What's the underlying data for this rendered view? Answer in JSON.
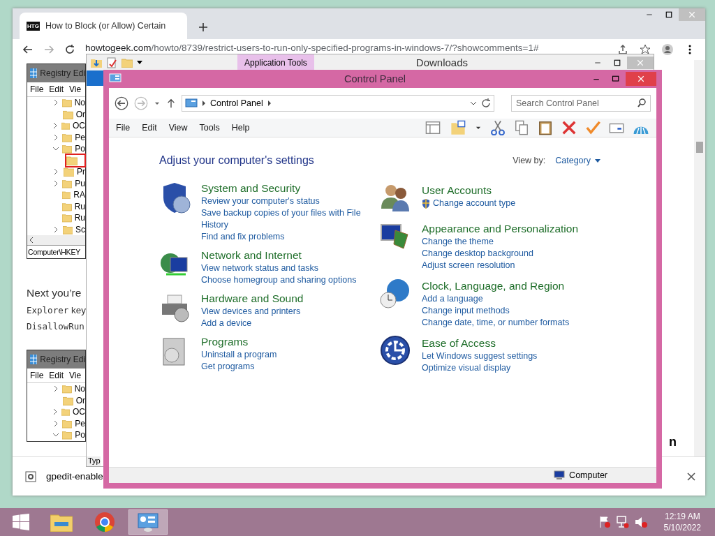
{
  "browser": {
    "tab": {
      "icon_text": "HTG",
      "title": "How to Block (or Allow) Certain"
    },
    "url": {
      "host": "howtogeek.com",
      "path": "/howto/8739/restrict-users-to-run-only-specified-programs-in-windows-7/?showcomments=1#"
    },
    "article": {
      "registry_shots": [
        {
          "title": "Registry Edi",
          "menu": [
            "File",
            "Edit",
            "Vie"
          ],
          "tree": [
            {
              "kind": "collapsed",
              "label": "No"
            },
            {
              "kind": "leaf",
              "label": "Or"
            },
            {
              "kind": "collapsed",
              "label": "OC"
            },
            {
              "kind": "collapsed",
              "label": "Pe"
            },
            {
              "kind": "expanded",
              "label": "Po"
            },
            {
              "kind": "child",
              "highlighted": true
            },
            {
              "kind": "collapsed",
              "label": "Pr"
            },
            {
              "kind": "collapsed",
              "label": "Pu"
            },
            {
              "kind": "leaf",
              "label": "RA"
            },
            {
              "kind": "leaf",
              "label": "Ru"
            },
            {
              "kind": "leaf",
              "label": "Ru"
            },
            {
              "kind": "collapsed",
              "label": "Sc"
            }
          ],
          "status": "Computer\\HKEY"
        },
        {
          "title": "Registry Edi",
          "menu": [
            "File",
            "Edit",
            "Vie"
          ],
          "tree": [
            {
              "kind": "collapsed",
              "label": "No"
            },
            {
              "kind": "leaf",
              "label": "Or"
            },
            {
              "kind": "collapsed",
              "label": "OC"
            },
            {
              "kind": "collapsed",
              "label": "Pe"
            },
            {
              "kind": "expanded",
              "label": "Po"
            }
          ]
        }
      ],
      "paragraph": "Next you’re",
      "code_lines": [
        {
          "code": "Explorer",
          "text": "key"
        },
        {
          "code": "DisallowRun"
        }
      ],
      "side_text": "n"
    },
    "download": {
      "file": "gpedit-enable"
    }
  },
  "downloads_window": {
    "ribbon_tab": "Application Tools",
    "title": "Downloads",
    "column": "Typ"
  },
  "control_panel": {
    "title": "Control Panel",
    "breadcrumb": "Control Panel",
    "search": {
      "placeholder": "Search Control Panel"
    },
    "menu": [
      "File",
      "Edit",
      "View",
      "Tools",
      "Help"
    ],
    "heading": "Adjust your computer's settings",
    "view_by": {
      "label": "View by:",
      "value": "Category"
    },
    "columns": [
      [
        {
          "kind": "security",
          "title": "System and Security",
          "links": [
            {
              "text": "Review your computer's status"
            },
            {
              "text": "Save backup copies of your files with File History"
            },
            {
              "text": "Find and fix problems"
            }
          ]
        },
        {
          "kind": "network",
          "title": "Network and Internet",
          "links": [
            {
              "text": "View network status and tasks"
            },
            {
              "text": "Choose homegroup and sharing options"
            }
          ]
        },
        {
          "kind": "hardware",
          "title": "Hardware and Sound",
          "links": [
            {
              "text": "View devices and printers"
            },
            {
              "text": "Add a device"
            }
          ]
        },
        {
          "kind": "programs",
          "title": "Programs",
          "links": [
            {
              "text": "Uninstall a program"
            },
            {
              "text": "Get programs"
            }
          ]
        }
      ],
      [
        {
          "kind": "users",
          "title": "User Accounts",
          "links": [
            {
              "text": "Change account type",
              "shield": true
            }
          ]
        },
        {
          "kind": "appearance",
          "title": "Appearance and Personalization",
          "links": [
            {
              "text": "Change the theme"
            },
            {
              "text": "Change desktop background"
            },
            {
              "text": "Adjust screen resolution"
            }
          ]
        },
        {
          "kind": "clock",
          "title": "Clock, Language, and Region",
          "links": [
            {
              "text": "Add a language"
            },
            {
              "text": "Change input methods"
            },
            {
              "text": "Change date, time, or number formats"
            }
          ]
        },
        {
          "kind": "ease",
          "title": "Ease of Access",
          "links": [
            {
              "text": "Let Windows suggest settings"
            },
            {
              "text": "Optimize visual display"
            }
          ]
        }
      ]
    ],
    "status": "Computer"
  },
  "taskbar": {
    "apps": [
      {
        "kind": "explorer",
        "selected": false
      },
      {
        "kind": "chrome",
        "selected": false
      },
      {
        "kind": "control",
        "selected": true
      }
    ],
    "clock": {
      "time": "12:19 AM",
      "date": "5/10/2022"
    }
  }
}
